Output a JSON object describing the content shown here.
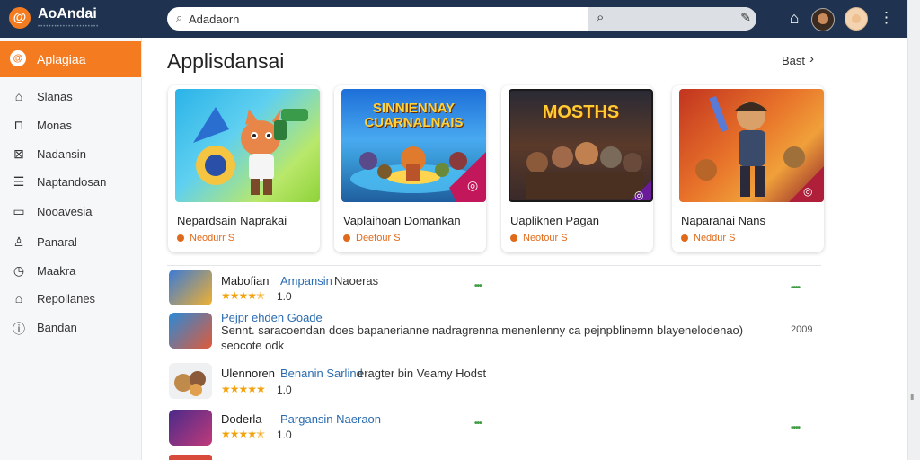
{
  "app": {
    "name": "AoAndai",
    "tagline": "••••••••••••••••••••••",
    "logo_glyph": "@"
  },
  "search": {
    "value": "Adadaorn",
    "placeholder": "Adadaorn"
  },
  "sidebar": {
    "active": {
      "label": "Aplagiaa",
      "icon": "app-icon"
    },
    "items": [
      {
        "label": "Slanas",
        "icon": "home-icon",
        "glyph": "⌂"
      },
      {
        "label": "Monas",
        "icon": "lock-icon",
        "glyph": "⊓"
      },
      {
        "label": "Nadansin",
        "icon": "image-icon",
        "glyph": "⊠"
      },
      {
        "label": "Naptandosan",
        "icon": "document-icon",
        "glyph": "☰"
      },
      {
        "label": "Nooavesia",
        "icon": "box-icon",
        "glyph": "▭"
      },
      {
        "label": "Panaral",
        "icon": "person-icon",
        "glyph": "♙"
      },
      {
        "label": "Maakra",
        "icon": "clock-icon",
        "glyph": "◷"
      },
      {
        "label": "Repollanes",
        "icon": "store-icon",
        "glyph": "⌂"
      },
      {
        "label": "Bandan",
        "icon": "info-icon",
        "glyph": "ⓘ"
      }
    ]
  },
  "main": {
    "title": "Applisdansai",
    "see_all": "Bast",
    "cards": [
      {
        "title": "Nepardsain Naprakai",
        "sub": "Neodurr S",
        "art_text": ""
      },
      {
        "title": "Vaplaihoan Domankan",
        "sub": "Deefour S",
        "art_text": "SINNIENNAY CUARNALNAIS"
      },
      {
        "title": "Uapliknen Pagan",
        "sub": "Neotour S",
        "art_text": "MOSTHS"
      },
      {
        "title": "Naparanai Nans",
        "sub": "Neddur S",
        "art_text": ""
      }
    ],
    "list": [
      {
        "name": "Mabofian",
        "link": "Ampansin",
        "extra": "Naoeras",
        "stars": "★★★★✭",
        "rating": "1.0",
        "green_mid": "•••",
        "green_right": "••••"
      },
      {
        "link": "Pejpr ehden Goade",
        "desc": "Sennt. saracoendan does bapanerianne nadragrenna menenlenny ca pejnpblinemn blayenelodenao)",
        "desc2": "seocote odk",
        "count": "2009"
      },
      {
        "name": "Ulennoren",
        "link": "Benanin Sarlind",
        "extra": "eragter bin Veamy Hodst",
        "stars": "★★★★★",
        "rating": "1.0"
      },
      {
        "name": "Doderla",
        "link": "Pargansin Naeraon",
        "stars": "★★★★✭",
        "rating": "1.0",
        "green_mid": "•••",
        "green_right": "••••"
      }
    ]
  },
  "colors": {
    "topbar": "#1f3350",
    "accent": "#f47b20",
    "link": "#2b6cb0",
    "star": "#f2a20c",
    "green": "#3d9b40"
  }
}
